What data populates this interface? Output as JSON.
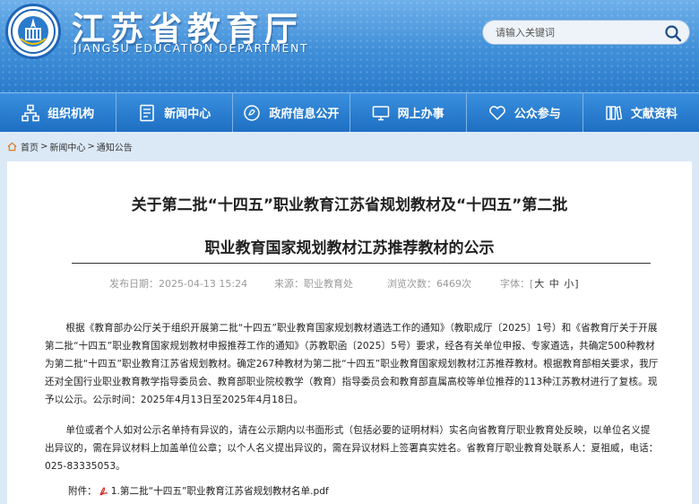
{
  "header": {
    "site_title": "江苏省教育厅",
    "site_subtitle": "JIANGSU EDUCATION DEPARTMENT",
    "search_placeholder": "请输入关键词"
  },
  "nav": {
    "items": [
      {
        "label": "组织机构",
        "icon": "org-chart-icon"
      },
      {
        "label": "新闻中心",
        "icon": "document-icon"
      },
      {
        "label": "政府信息公开",
        "icon": "info-disclosure-icon"
      },
      {
        "label": "网上办事",
        "icon": "monitor-icon"
      },
      {
        "label": "公众参与",
        "icon": "heart-icon"
      },
      {
        "label": "文献资料",
        "icon": "books-icon"
      }
    ]
  },
  "breadcrumb": {
    "home": "首页",
    "sep1": ">",
    "news": "新闻中心",
    "sep2": ">",
    "current": "通知公告"
  },
  "article": {
    "title_line1": "关于第二批“十四五”职业教育江苏省规划教材及“十四五”第二批",
    "title_line2": "职业教育国家规划教材江苏推荐教材的公示",
    "published": "发布日期：2025-04-13 15:24",
    "source": "来源：职业教育处",
    "views": "浏览次数：6469次",
    "font_label": "字体：[",
    "font_large": "大",
    "font_medium": "中",
    "font_small": "小",
    "font_close": "]",
    "paragraph1": "根据《教育部办公厅关于组织开展第二批“十四五”职业教育国家规划教材遴选工作的通知》（教职成厅〔2025〕1号）和《省教育厅关于开展第二批“十四五”职业教育国家规划教材申报推荐工作的通知》（苏教职函〔2025〕5号）要求，经各有关单位申报、专家遴选，共确定500种教材为第二批“十四五”职业教育江苏省规划教材。确定267种教材为第二批“十四五”职业教育国家规划教材江苏推荐教材。根据教育部相关要求，我厅还对全国行业职业教育教学指导委员会、教育部职业院校教学（教育）指导委员会和教育部直属高校等单位推荐的113种江苏教材进行了复核。现予以公示。公示时间：2025年4月13日至2025年4月18日。",
    "paragraph2": "单位或者个人如对公示名单持有异议的，请在公示期内以书面形式（包括必要的证明材料）实名向省教育厅职业教育处反映，以单位名义提出异议的，需在异议材料上加盖单位公章；以个人名义提出异议的，需在异议材料上签署真实姓名。省教育厅职业教育处联系人：夏祖威，电话：025-83335053。",
    "attachment_label": "附件：",
    "attachment_file": "1.第二批“十四五”职业教育江苏省规划教材名单.pdf"
  },
  "colors": {
    "header_blue": "#3f8fd8",
    "nav_blue": "#1e6fc2",
    "page_bg": "#dbe9f7"
  }
}
